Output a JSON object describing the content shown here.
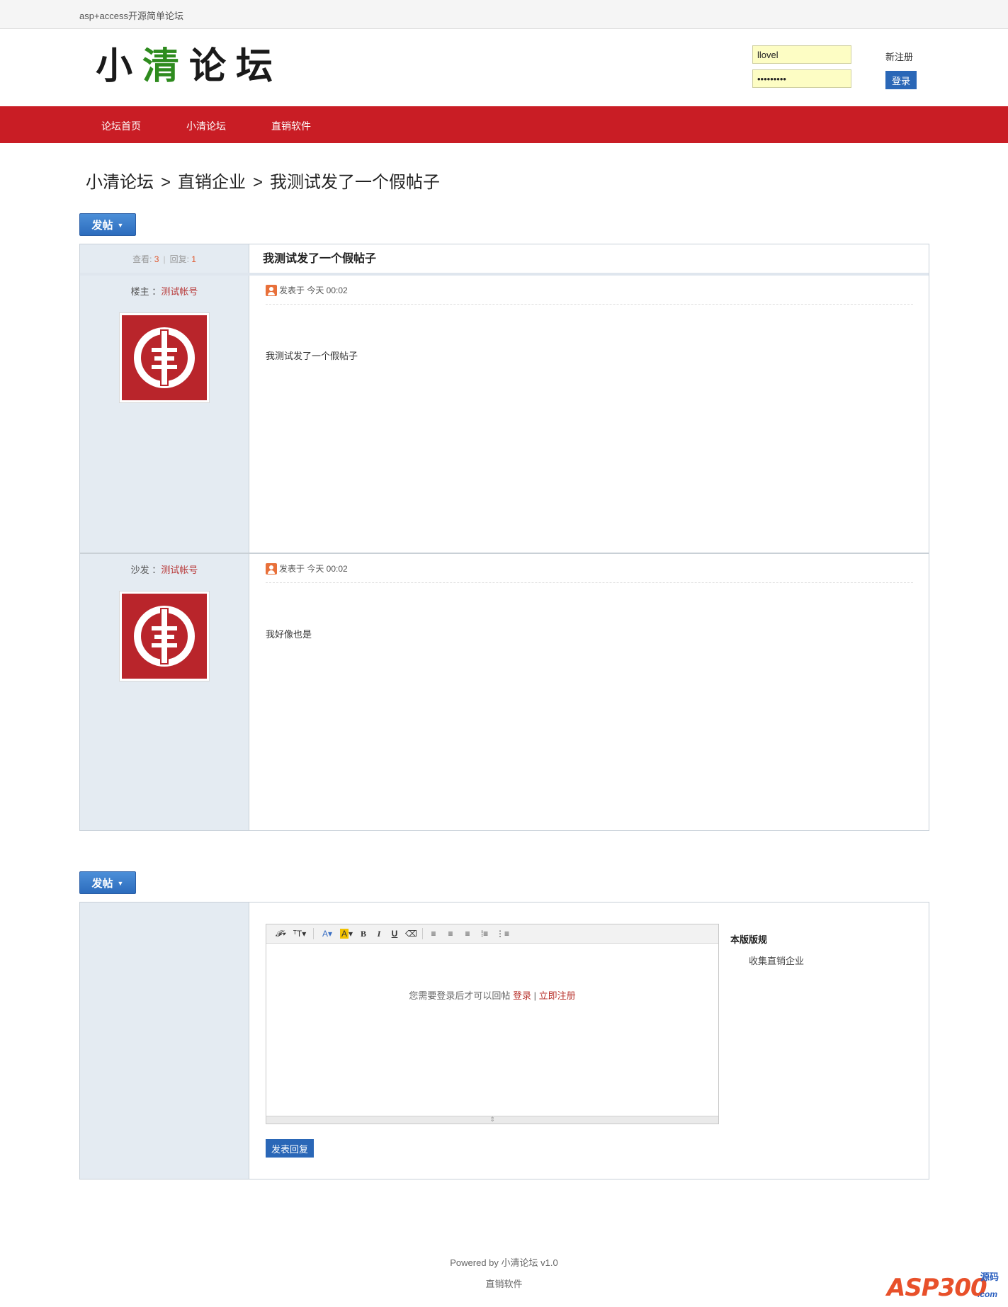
{
  "topbar": {
    "site_name": "asp+access开源简单论坛"
  },
  "header": {
    "logo_a": "小",
    "logo_b": "清",
    "logo_c": "论坛",
    "username_value": "llovel",
    "password_value": "•••••••••",
    "register_label": "新注册",
    "login_label": "登录"
  },
  "nav": {
    "items": [
      "论坛首页",
      "小清论坛",
      "直销软件"
    ]
  },
  "breadcrumb": {
    "forum": "小清论坛",
    "sep": ">",
    "board": "直销企业",
    "thread": "我测试发了一个假帖子"
  },
  "post_button": {
    "label": "发帖"
  },
  "thread": {
    "views_label": "查看:",
    "views": "3",
    "replies_label": "回复:",
    "replies": "1",
    "title": "我测试发了一个假帖子",
    "posts": [
      {
        "role": "楼主",
        "colon": "：",
        "author": "测试帐号",
        "meta": "发表于 今天 00:02",
        "content": "我测试发了一个假帖子"
      },
      {
        "role": "沙发",
        "colon": "：",
        "author": "测试帐号",
        "meta": "发表于 今天 00:02",
        "content": "我好像也是"
      }
    ]
  },
  "reply": {
    "notice_prefix": "您需要登录后才可以回帖",
    "login_link": "登录",
    "divider": "|",
    "register_link": "立即注册",
    "submit_label": "发表回复",
    "rules_title": "本版版规",
    "rules_text": "收集直销企业"
  },
  "footer": {
    "powered": "Powered by 小清论坛 v1.0",
    "link": "直销软件"
  },
  "watermark": {
    "logo": "ASP300",
    "tag": "源码",
    "domain": ".com"
  },
  "colors": {
    "nav_bg": "#c91d25",
    "logo_accent": "#2e8b1e",
    "button_blue": "#2a67b7",
    "sidebar_bg": "#e4ebf2",
    "author_red": "#b83a3a"
  }
}
